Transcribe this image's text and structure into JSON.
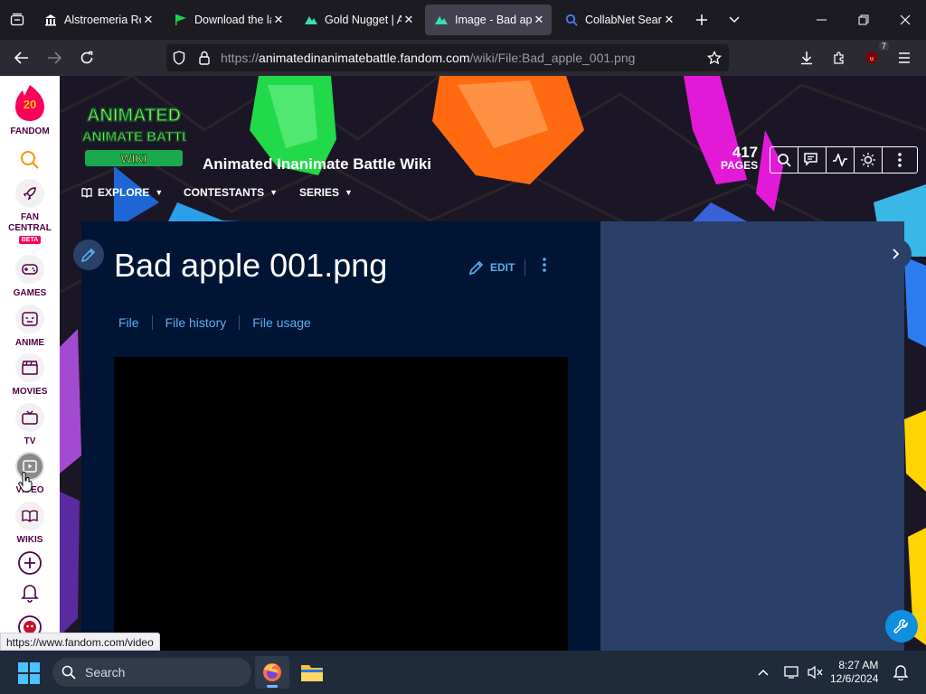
{
  "browser": {
    "tabs": [
      {
        "title": "Alstroemeria Re",
        "favicon": "museum-icon",
        "active": false
      },
      {
        "title": "Download the la",
        "favicon": "green-flag-icon",
        "active": false
      },
      {
        "title": "Gold Nugget | A",
        "favicon": "fandom-wiki-icon",
        "active": false
      },
      {
        "title": "Image - Bad app",
        "favicon": "fandom-wiki-icon",
        "active": true
      },
      {
        "title": "CollabNet Searc",
        "favicon": "search-icon",
        "active": false
      }
    ],
    "url_prefix": "https://",
    "url_host": "animatedinanimatebattle.fandom.com",
    "url_path": "/wiki/File:Bad_apple_001.png",
    "extension_badge": "7"
  },
  "global_nav": {
    "logo_text": "20",
    "fandom_label": "FANDOM",
    "items": [
      {
        "label": "FAN CENTRAL",
        "badge": "BETA"
      },
      {
        "label": "GAMES"
      },
      {
        "label": "ANIME"
      },
      {
        "label": "MOVIES"
      },
      {
        "label": "TV"
      },
      {
        "label": "VIDEO"
      },
      {
        "label": "WIKIS"
      }
    ]
  },
  "wiki": {
    "logo_lines": [
      "ANIMATED",
      "INANIMATE BATTLE",
      "WIKI"
    ],
    "name": "Animated Inanimate Battle Wiki",
    "nav": [
      "EXPLORE",
      "CONTESTANTS",
      "SERIES"
    ],
    "pages_count": "417",
    "pages_label": "PAGES",
    "page_title": "Bad apple 001.png",
    "edit_label": "EDIT",
    "file_tabs": [
      "File",
      "File history",
      "File usage"
    ]
  },
  "status_link": "https://www.fandom.com/video",
  "taskbar": {
    "search_placeholder": "Search",
    "time": "8:27 AM",
    "date": "12/6/2024"
  },
  "colors": {
    "fandom_pink": "#fa005a",
    "page_bg": "#001534",
    "rail_bg": "#2a4068",
    "link": "#5aaef0"
  }
}
